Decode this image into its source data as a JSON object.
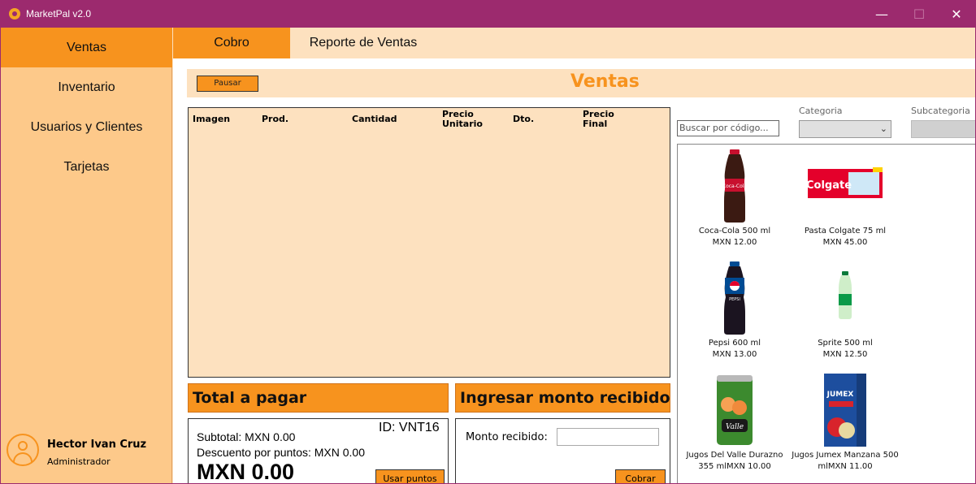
{
  "window": {
    "title": "MarketPal v2.0",
    "minimize": "—",
    "maximize": "☐",
    "close": "✕"
  },
  "sidebar": {
    "items": [
      {
        "label": "Ventas"
      },
      {
        "label": "Inventario"
      },
      {
        "label": "Usuarios y Clientes"
      },
      {
        "label": "Tarjetas"
      }
    ],
    "user": {
      "name": "Hector Ivan Cruz",
      "role": "Administrador"
    }
  },
  "tabs": [
    {
      "label": "Cobro"
    },
    {
      "label": "Reporte de Ventas"
    }
  ],
  "sale": {
    "pause_label": "Pausar",
    "title": "Ventas",
    "columns": [
      "Imagen",
      "Prod.",
      "Cantidad",
      "Precio Unitario",
      "Dto.",
      "Precio Final"
    ],
    "col_precio_unit_1": "Precio",
    "col_precio_unit_2": "Unitario",
    "col_precio_final_1": "Precio",
    "col_precio_final_2": "Final"
  },
  "totals": {
    "header": "Total a pagar",
    "id": "ID: VNT16",
    "subtotal": "Subtotal: MXN 0.00",
    "discount": "Descuento por puntos: MXN 0.00",
    "total": "MXN 0.00",
    "use_points_label": "Usar puntos"
  },
  "payment": {
    "header": "Ingresar monto recibido",
    "label": "Monto recibido:",
    "value": "",
    "charge_label": "Cobrar"
  },
  "filters": {
    "search_placeholder": "Buscar por código...",
    "category_label": "Categoria",
    "category_value": "",
    "subcategory_label": "Subcategoria"
  },
  "products": [
    {
      "name": "Coca-Cola 500 ml",
      "price": "MXN 12.00",
      "icon": "coca-cola-bottle"
    },
    {
      "name": "Pasta Colgate 75 ml",
      "price": "MXN 45.00",
      "icon": "colgate-box"
    },
    {
      "name": "Pepsi 600 ml",
      "price": "MXN 13.00",
      "icon": "pepsi-bottle"
    },
    {
      "name": "Sprite 500 ml",
      "price": "MXN 12.50",
      "icon": "sprite-bottle"
    },
    {
      "name": "Jugos Del Valle Durazno",
      "name2": "355 mlMXN 10.00",
      "price": "",
      "icon": "del-valle-can"
    },
    {
      "name": "Jugos Jumex Manzana 500",
      "name2": "mlMXN 11.00",
      "price": "",
      "icon": "jumex-carton"
    }
  ],
  "brand_text": {
    "colgate": "Colgate",
    "pepsi": "PEPSI",
    "valle": "Valle",
    "jumex": "JUMEX"
  },
  "colors": {
    "accent": "#f7931e",
    "titlebar": "#9c2a6e",
    "panel": "#fde1bf",
    "sidebar": "#fdc98a"
  }
}
